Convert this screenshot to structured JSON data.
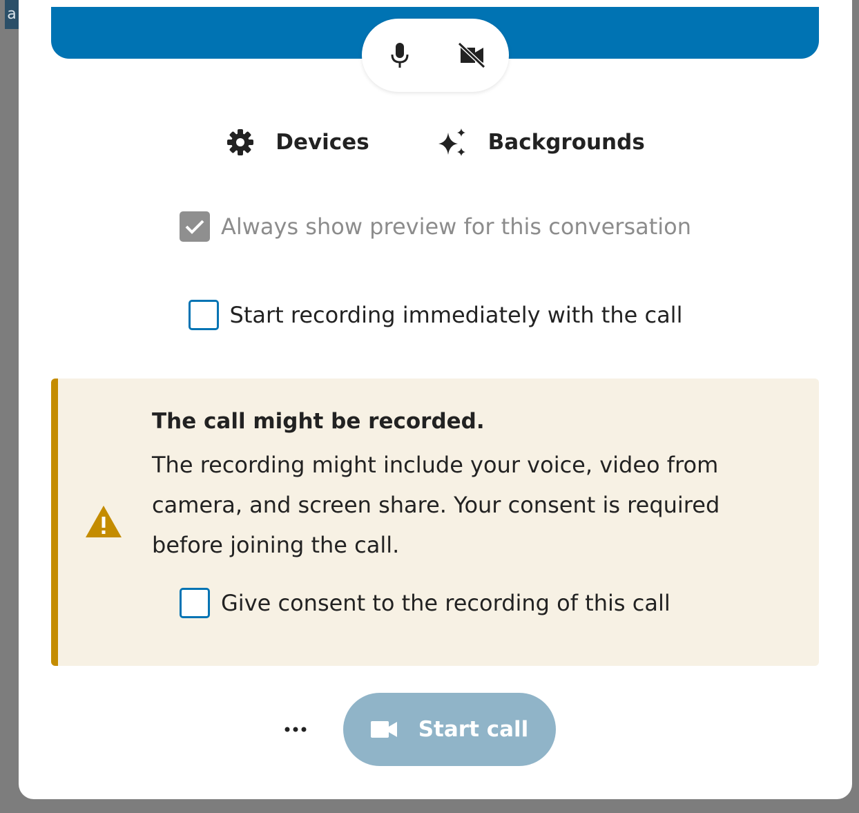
{
  "edge_tab": {
    "label": "a"
  },
  "media_controls": {
    "mic_icon": "microphone-icon",
    "camera_icon": "video-off-icon"
  },
  "tabs": [
    {
      "label": "Devices",
      "icon": "gear-icon"
    },
    {
      "label": "Backgrounds",
      "icon": "sparkles-icon"
    }
  ],
  "options": {
    "always_preview": {
      "label": "Always show preview for this conversation",
      "checked": true,
      "disabled": true
    },
    "start_recording": {
      "label": "Start recording immediately with the call",
      "checked": false
    }
  },
  "recording_notice": {
    "icon": "warning-icon",
    "title": "The call might be recorded.",
    "body": "The recording might include your voice, video from camera, and screen share. Your consent is required before joining the call.",
    "consent_label": "Give consent to the recording of this call",
    "consent_checked": false
  },
  "footer": {
    "more_icon": "more-options-icon",
    "start_call_label": "Start call",
    "start_call_icon": "video-camera-icon",
    "start_call_disabled": true
  },
  "colors": {
    "primary": "#0073b3",
    "warning_accent": "#c48c00",
    "warning_background": "#f7f1e4",
    "disabled_button": "#90b4c8"
  }
}
